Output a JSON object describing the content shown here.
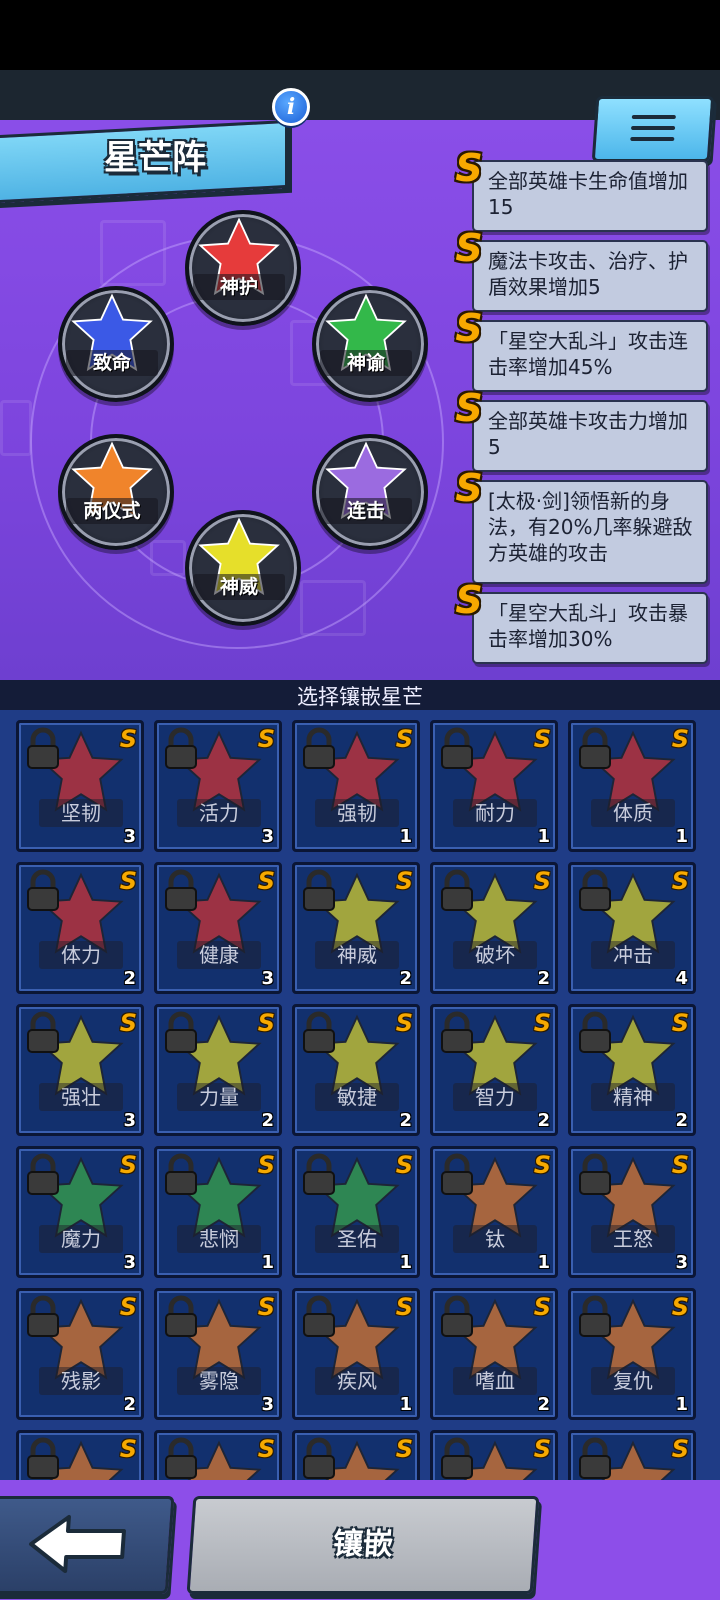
{
  "header": {
    "title": "星芒阵",
    "info_icon_glyph": "i",
    "menu_icon": "hamburger-menu-icon"
  },
  "formation": {
    "slots": [
      {
        "label": "神护",
        "color": "#e63b3b"
      },
      {
        "label": "致命",
        "color": "#3b59e6"
      },
      {
        "label": "神谕",
        "color": "#33b84a"
      },
      {
        "label": "两仪式",
        "color": "#f0842b"
      },
      {
        "label": "连击",
        "color": "#9b6be0"
      },
      {
        "label": "神威",
        "color": "#e6df2a"
      }
    ]
  },
  "bonuses": [
    {
      "badge": "S",
      "text": "全部英雄卡生命值增加15"
    },
    {
      "badge": "S",
      "text": "魔法卡攻击、治疗、护盾效果增加5"
    },
    {
      "badge": "S",
      "text": "「星空大乱斗」攻击连击率增加45%"
    },
    {
      "badge": "S",
      "text": "全部英雄卡攻击力增加5"
    },
    {
      "badge": "S",
      "text": "[太极·剑]领悟新的身法，有20%几率躲避敌方英雄的攻击"
    },
    {
      "badge": "S",
      "text": "「星空大乱斗」攻击暴击率增加30%"
    }
  ],
  "grid": {
    "header": "选择镶嵌星芒",
    "cards": [
      {
        "name": "坚韧",
        "count": "3",
        "color": "#d23434",
        "grade": "S"
      },
      {
        "name": "活力",
        "count": "3",
        "color": "#d23434",
        "grade": "S"
      },
      {
        "name": "强韧",
        "count": "1",
        "color": "#d23434",
        "grade": "S"
      },
      {
        "name": "耐力",
        "count": "1",
        "color": "#d23434",
        "grade": "S"
      },
      {
        "name": "体质",
        "count": "1",
        "color": "#d23434",
        "grade": "S"
      },
      {
        "name": "体力",
        "count": "2",
        "color": "#d23434",
        "grade": "S"
      },
      {
        "name": "健康",
        "count": "3",
        "color": "#d23434",
        "grade": "S"
      },
      {
        "name": "神威",
        "count": "2",
        "color": "#d8d22c",
        "grade": "S"
      },
      {
        "name": "破坏",
        "count": "2",
        "color": "#d8d22c",
        "grade": "S"
      },
      {
        "name": "冲击",
        "count": "4",
        "color": "#d8d22c",
        "grade": "S"
      },
      {
        "name": "强壮",
        "count": "3",
        "color": "#d8d22c",
        "grade": "S"
      },
      {
        "name": "力量",
        "count": "2",
        "color": "#d8d22c",
        "grade": "S"
      },
      {
        "name": "敏捷",
        "count": "2",
        "color": "#d8d22c",
        "grade": "S"
      },
      {
        "name": "智力",
        "count": "2",
        "color": "#d8d22c",
        "grade": "S"
      },
      {
        "name": "精神",
        "count": "2",
        "color": "#d8d22c",
        "grade": "S"
      },
      {
        "name": "魔力",
        "count": "3",
        "color": "#3aa84a",
        "grade": "S"
      },
      {
        "name": "悲悯",
        "count": "1",
        "color": "#3aa84a",
        "grade": "S"
      },
      {
        "name": "圣佑",
        "count": "1",
        "color": "#3aa84a",
        "grade": "S"
      },
      {
        "name": "钛",
        "count": "1",
        "color": "#e07a2e",
        "grade": "S"
      },
      {
        "name": "王怒",
        "count": "3",
        "color": "#e07a2e",
        "grade": "S"
      },
      {
        "name": "残影",
        "count": "2",
        "color": "#e07a2e",
        "grade": "S"
      },
      {
        "name": "雾隐",
        "count": "3",
        "color": "#e07a2e",
        "grade": "S"
      },
      {
        "name": "疾风",
        "count": "1",
        "color": "#e07a2e",
        "grade": "S"
      },
      {
        "name": "嗜血",
        "count": "2",
        "color": "#e07a2e",
        "grade": "S"
      },
      {
        "name": "复仇",
        "count": "1",
        "color": "#e07a2e",
        "grade": "S"
      },
      {
        "name": "",
        "count": "",
        "color": "#e07a2e",
        "grade": "S"
      },
      {
        "name": "",
        "count": "",
        "color": "#e07a2e",
        "grade": "S"
      },
      {
        "name": "",
        "count": "",
        "color": "#e07a2e",
        "grade": "S"
      },
      {
        "name": "",
        "count": "",
        "color": "#e07a2e",
        "grade": "S"
      },
      {
        "name": "",
        "count": "",
        "color": "#e07a2e",
        "grade": "S"
      }
    ]
  },
  "footer": {
    "back_icon": "arrow-left-icon",
    "embed_label": "镶嵌"
  }
}
